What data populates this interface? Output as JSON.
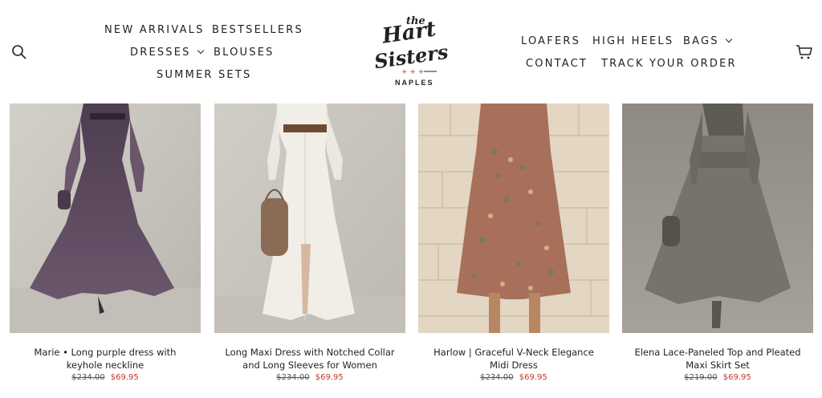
{
  "nav": {
    "left": [
      {
        "label": "NEW ARRIVALS"
      },
      {
        "label": "BESTSELLERS"
      },
      {
        "label": "DRESSES"
      },
      {
        "label": "BLOUSES"
      },
      {
        "label": "SUMMER SETS"
      }
    ],
    "right": [
      {
        "label": "LOAFERS"
      },
      {
        "label": "HIGH HEELS"
      },
      {
        "label": "BAGS"
      },
      {
        "label": "CONTACT"
      },
      {
        "label": "TRACK YOUR ORDER"
      }
    ]
  },
  "logo": {
    "the": "the",
    "hart": "Hart",
    "sisters": "Sisters",
    "city": "NAPLES"
  },
  "icons": {
    "search": "search-icon",
    "cart": "cart-icon"
  },
  "products": [
    {
      "title": "Marie • Long purple dress with keyhole neckline",
      "price_old": "$234.00",
      "price_new": "$69.95",
      "bg": "#c9c5bf",
      "garment": "#5e4a5f"
    },
    {
      "title": "Long Maxi Dress with Notched Collar and Long Sleeves for Women",
      "price_old": "$234.00",
      "price_new": "$69.95",
      "bg": "#c8c4be",
      "garment": "#eeebe4"
    },
    {
      "title": "Harlow | Graceful V-Neck Elegance Midi Dress",
      "price_old": "$234.00",
      "price_new": "$69.95",
      "bg": "#e2d4c0",
      "garment": "#a86f52"
    },
    {
      "title": "Elena Lace-Paneled Top and Pleated Maxi Skirt Set",
      "price_old": "$219.00",
      "price_new": "$69.95",
      "bg": "#9c9890",
      "garment": "#7d7a72"
    }
  ],
  "colors": {
    "sale": "#c0392b",
    "text": "#1f1f1f"
  }
}
